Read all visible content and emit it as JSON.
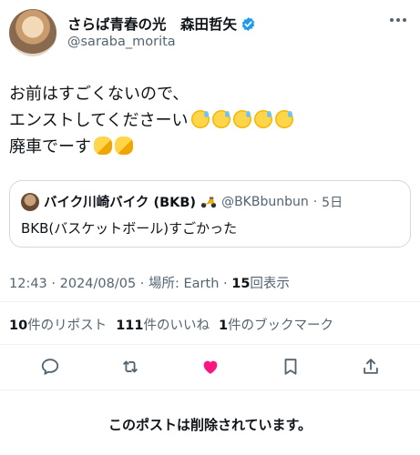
{
  "author": {
    "display_name": "さらば青春の光　森田哲矢",
    "handle": "@saraba_morita"
  },
  "post": {
    "lines": [
      "お前はすごくないので、",
      "エンストしてくださーい",
      "廃車でーす"
    ],
    "line2_emoji_count": 5,
    "line3_emoji_count": 2
  },
  "quote": {
    "name": "バイク川崎バイク (BKB)",
    "handle": "@BKBbunbun",
    "separator": "·",
    "age": "5日",
    "text": "BKB(バスケットボール)すごかった"
  },
  "meta": {
    "time_date": "12:43 · 2024/08/05",
    "location_prefix": " · 場所: Earth · ",
    "views_count": "15",
    "views_label": "回表示"
  },
  "stats": {
    "reposts_count": "10",
    "reposts_label": "件のリポスト",
    "likes_count": "111",
    "likes_label": "件のいいね",
    "bookmarks_count": "1",
    "bookmarks_label": "件のブックマーク"
  },
  "actions": {
    "reply_icon": "reply-icon",
    "repost_icon": "repost-icon",
    "like_icon": "heart-icon",
    "bookmark_icon": "bookmark-icon",
    "share_icon": "share-icon"
  },
  "colors": {
    "verified": "#1d9bf0",
    "like_active": "#f91880",
    "secondary_text": "#536471"
  },
  "deleted_notice": "このポストは削除されています。"
}
